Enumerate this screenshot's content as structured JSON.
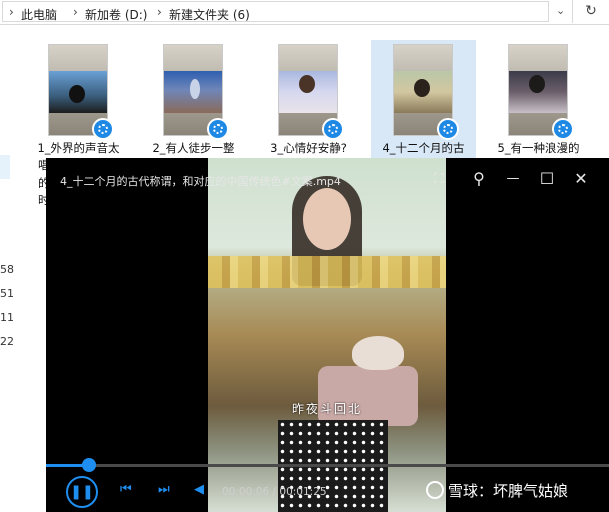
{
  "breadcrumb": [
    "此电脑",
    "新加卷 (D:)",
    "新建文件夹 (6)"
  ],
  "breadcrumb_sep": "›",
  "address_dropdown_icon": "chevron-down-icon",
  "refresh_icon": "refresh-icon",
  "refresh_glyph": "↻",
  "dropdown_glyph": "⌄",
  "side_numbers": [
    "58",
    "51",
    "11",
    "22"
  ],
  "files": [
    {
      "name": "1_外界的声音太",
      "selected": false
    },
    {
      "name": "2_有人徒步一整",
      "selected": false
    },
    {
      "name": "3_心情好安静?",
      "selected": false
    },
    {
      "name": "4_十二个月的古",
      "selected": true
    },
    {
      "name": "5_有一种浪漫的",
      "selected": false
    }
  ],
  "background_wrapped_text": [
    "唱",
    "的",
    "时"
  ],
  "player": {
    "title": "4_十二个月的古代称谓，和对应的中国传统色#文案.mp4",
    "subtitle": "昨夜斗回北",
    "time_current": "00:00:06",
    "time_total": "00:01:25",
    "time_sep": " / ",
    "progress_fraction": 0.07,
    "buttons": {
      "fullscreen_glyph": "⛶",
      "pin_glyph": "⚲",
      "minimize_glyph": "—",
      "maximize_glyph": "☐",
      "close_glyph": "✕",
      "play_pause_glyph": "❚❚",
      "prev_glyph": "⏮",
      "next_glyph": "⏭",
      "volume_glyph": "◀"
    },
    "accent_color": "#1e8ff0"
  },
  "watermark": "雪球：坏脾气姑娘"
}
